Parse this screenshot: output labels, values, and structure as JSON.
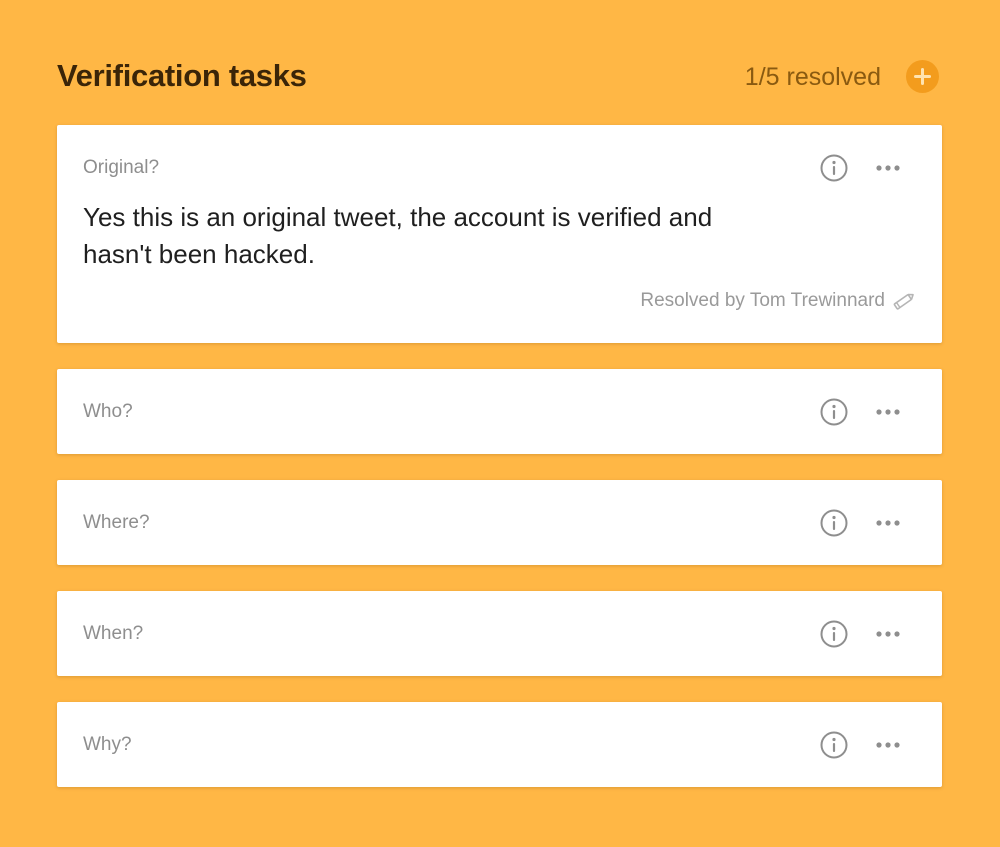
{
  "header": {
    "title": "Verification tasks",
    "resolved_count": "1/5 resolved",
    "add_icon": "plus-circle-icon"
  },
  "tasks": [
    {
      "label": "Original?",
      "answer": "Yes this is an original tweet, the account is verified and hasn't been hacked.",
      "resolved_by": "Resolved by Tom Trewinnard",
      "resolved": true
    },
    {
      "label": "Who?",
      "resolved": false
    },
    {
      "label": "Where?",
      "resolved": false
    },
    {
      "label": "When?",
      "resolved": false
    },
    {
      "label": "Why?",
      "resolved": false
    }
  ],
  "icons": {
    "info": "info-icon",
    "more": "more-horizontal-icon",
    "edit": "pencil-icon"
  },
  "colors": {
    "background": "#FFB745",
    "accent": "#F39C1D",
    "title": "#3B2508",
    "muted": "#8E8E8E"
  }
}
